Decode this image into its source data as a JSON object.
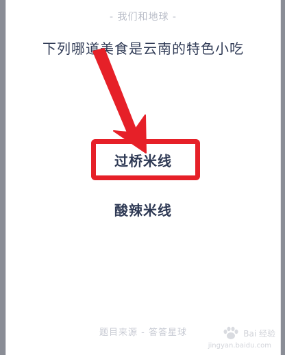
{
  "header": {
    "title": "- 我们和地球 -"
  },
  "question": {
    "text": "下列哪道美食是云南的特色小吃"
  },
  "options": [
    {
      "label": "过桥米线",
      "highlighted": true
    },
    {
      "label": "酸辣米线",
      "highlighted": false
    }
  ],
  "footer": {
    "source": "题目来源 - 答答星球"
  },
  "watermark": {
    "brand": "Bai 经验",
    "url": "jingyan.baidu.com"
  },
  "colors": {
    "accent_red": "#e62028",
    "text_primary": "#2f3a55",
    "text_muted": "#b9bdc8"
  },
  "icons": {
    "annotation": "red-arrow-icon",
    "watermark": "paw-logo-icon"
  }
}
